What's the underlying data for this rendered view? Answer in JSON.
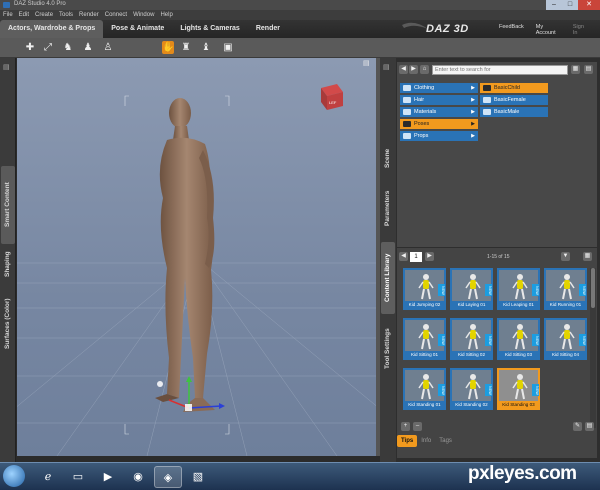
{
  "window": {
    "title": "DAZ Studio 4.0 Pro"
  },
  "menu": [
    "File",
    "Edit",
    "Create",
    "Tools",
    "Render",
    "Connect",
    "Window",
    "Help"
  ],
  "tabs": [
    {
      "label": "Actors, Wardrobe & Props",
      "active": true
    },
    {
      "label": "Pose & Animate",
      "active": false
    },
    {
      "label": "Lights & Cameras",
      "active": false
    },
    {
      "label": "Render",
      "active": false
    }
  ],
  "brand": {
    "logo": "DAZ 3D"
  },
  "header_links": {
    "feedback": "FeedBack",
    "account": "My Account",
    "signout": "Sign In"
  },
  "left_dock": {
    "tabs": [
      "Smart Content",
      "Shaping",
      "Surfaces (Color)"
    ]
  },
  "right_dock": {
    "tabs": [
      "Scene",
      "Parameters",
      "Content Library",
      "Tool Settings"
    ]
  },
  "library": {
    "search_placeholder": "Enter text to search for",
    "categories": [
      "Clothing",
      "Hair",
      "Materials",
      "Poses",
      "Props"
    ],
    "subcategories": [
      "BasicChild",
      "BasicFemale",
      "BasicMale"
    ],
    "page": "1",
    "range": "1-15 of 15",
    "items": [
      "Kid Jumping 02",
      "Kid Laying 01",
      "Kid Leaping 01",
      "Kid Running 01",
      "Kid Sitting 01",
      "Kid Sitting 02",
      "Kid Sitting 03",
      "Kid Sitting 04",
      "Kid Standing 01",
      "Kid Standing 02",
      "Kid Standing 03"
    ],
    "new_badge": "NEW",
    "selected_item": "Kid Standing 03"
  },
  "bottom_tabs": [
    {
      "label": "Tips",
      "active": true
    },
    {
      "label": "Info",
      "active": false
    },
    {
      "label": "Tags",
      "active": false
    }
  ],
  "colors": {
    "accent": "#f29a1e",
    "folder_blue": "#2a73b6",
    "viewport": "#8596b0"
  },
  "watermark": "pxleyes.com"
}
